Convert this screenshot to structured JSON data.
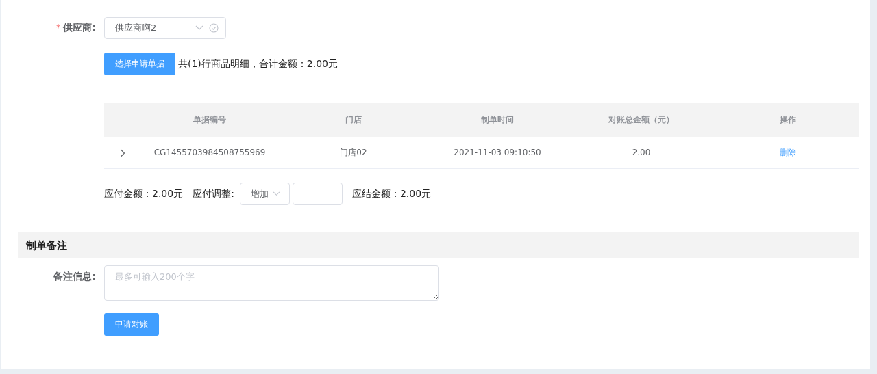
{
  "supplier": {
    "label": "供应商:",
    "required_mark": "*",
    "value": "供应商啊2"
  },
  "select_button": "选择申请单据",
  "summary": "共(1)行商品明细，合计金额：2.00元",
  "table": {
    "columns": [
      "单据编号",
      "门店",
      "制单时间",
      "对账总金额（元）",
      "操作"
    ],
    "rows": [
      {
        "expanded": false,
        "cells": [
          "CG1455703984508755969",
          "门店02",
          "2021-11-03 09:10:50",
          "2.00"
        ],
        "action": "删除"
      }
    ]
  },
  "payment": {
    "payable": "应付金额：2.00元",
    "adjust_label": "应付调整:",
    "adjust_type": "增加",
    "settle": "应结金额：2.00元"
  },
  "remarks_section": {
    "title": "制单备注",
    "label": "备注信息:",
    "placeholder": "最多可输入200个字"
  },
  "submit_button": "申请对账"
}
